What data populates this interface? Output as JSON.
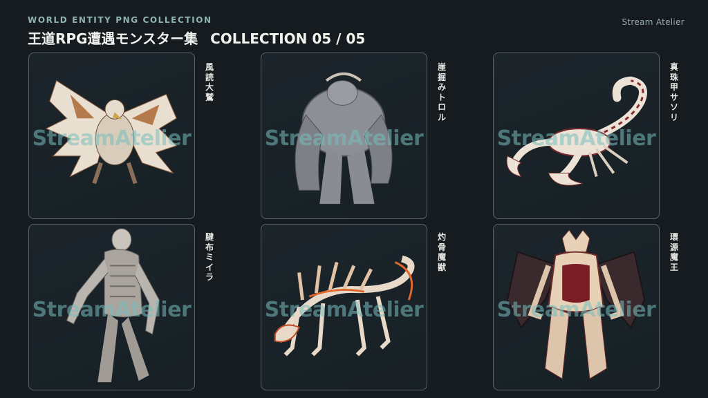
{
  "header": {
    "eyebrow": "WORLD ENTITY PNG COLLECTION",
    "title_jp": "王道RPG遭遇モンスター集",
    "title_collection": "COLLECTION 05 / 05",
    "brand": "Stream Atelier"
  },
  "watermark": "StreamAtelier",
  "cards": [
    {
      "name": "風読大鷲",
      "icon": "griffin-eagle-icon"
    },
    {
      "name": "崖掘みトロル",
      "icon": "troll-icon"
    },
    {
      "name": "真珠甲サソリ",
      "icon": "scorpion-icon"
    },
    {
      "name": "腱布ミイラ",
      "icon": "mummy-icon"
    },
    {
      "name": "灼骨魔獣",
      "icon": "bone-beast-icon"
    },
    {
      "name": "環源魔王",
      "icon": "demon-lord-icon"
    }
  ],
  "colors": {
    "background": "#151b1f",
    "card_border": "#56636a",
    "watermark": "#78bebe",
    "eyebrow": "#8fb3b3"
  }
}
